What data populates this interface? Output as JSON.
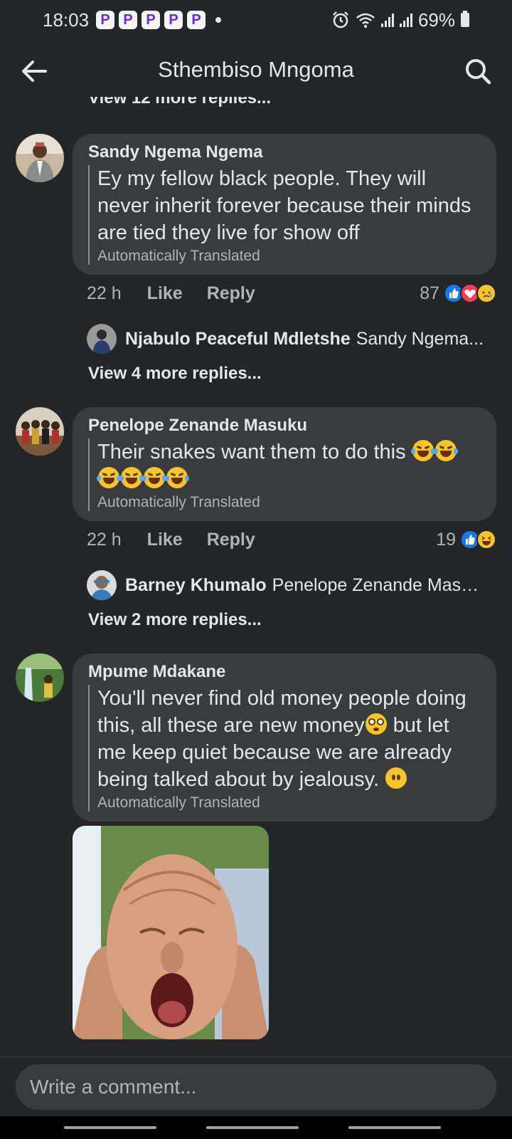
{
  "status": {
    "time": "18:03",
    "app_badges": [
      "P",
      "P",
      "P",
      "P",
      "P"
    ],
    "battery": "69%"
  },
  "header": {
    "title": "Sthembiso Mngoma"
  },
  "top_view_more": "View 12 more replies...",
  "comments": [
    {
      "author": "Sandy Ngema Ngema",
      "text": "Ey my fellow black people. They will never inherit forever because their minds are tied they live for show off",
      "translated": "Automatically Translated",
      "time": "22 h",
      "like": "Like",
      "reply": "Reply",
      "reaction_count": "87",
      "reactions": [
        "like",
        "love",
        "sad"
      ],
      "reply_preview": {
        "author": "Njabulo Peaceful Mdletshe",
        "text": "Sandy Ngema..."
      },
      "view_more": "View 4 more replies..."
    },
    {
      "author": "Penelope Zenande Masuku",
      "text": "Their snakes want them to do this",
      "translated": "Automatically Translated",
      "time": "22 h",
      "like": "Like",
      "reply": "Reply",
      "reaction_count": "19",
      "reactions": [
        "like",
        "haha"
      ],
      "reply_preview": {
        "author": "Barney Khumalo",
        "text": "Penelope Zenande Masuk..."
      },
      "view_more": "View 2 more replies..."
    },
    {
      "author": "Mpume Mdakane",
      "text_part1": "You'll never find old money people doing this, all these are new money",
      "text_part2": " but let me keep quiet because we are already being talked about by jealousy.",
      "translated": "Automatically Translated"
    }
  ],
  "composer": {
    "placeholder": "Write a comment..."
  }
}
